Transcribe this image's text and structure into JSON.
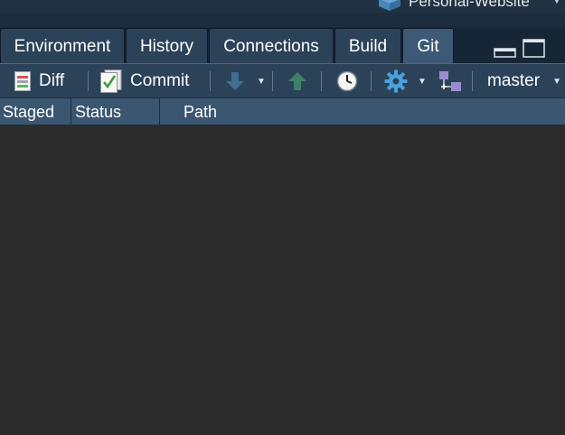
{
  "project": {
    "name": "Personal-Website",
    "icon": "project-cube-icon"
  },
  "tabs": [
    {
      "label": "Environment",
      "active": false
    },
    {
      "label": "History",
      "active": false
    },
    {
      "label": "Connections",
      "active": false
    },
    {
      "label": "Build",
      "active": false
    },
    {
      "label": "Git",
      "active": true
    }
  ],
  "toolbar": {
    "diff_label": "Diff",
    "commit_label": "Commit",
    "branch": "master",
    "icons": [
      "diff-icon",
      "commit-icon",
      "pull-arrow-down-icon",
      "push-arrow-up-icon",
      "history-clock-icon",
      "gear-icon",
      "new-branch-icon"
    ]
  },
  "columns": {
    "staged": "Staged",
    "status": "Status",
    "path": "Path"
  },
  "colors": {
    "tab_bg": "#2b4259",
    "tab_active_bg": "#3c5a76",
    "header_bg": "#3a5670",
    "list_bg": "#2b2b2b"
  }
}
